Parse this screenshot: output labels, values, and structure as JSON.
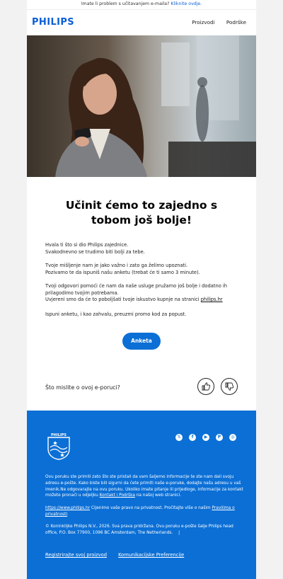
{
  "preheader": {
    "text": "Imate li problem s učitavanjem e-maila?",
    "link": "Kliknite ovdje."
  },
  "brand": {
    "logo": "PHILIPS",
    "emblem_word": "PHILIPS"
  },
  "nav": {
    "products": "Proizvodi",
    "support": "Podrške"
  },
  "main": {
    "headline": "Učinit ćemo to zajedno s tobom još bolje!",
    "p1_line1": "Hvala ti što si dio Philips zajednice.",
    "p1_line2": "Svakodnevno se trudimo biti bolji za tebe.",
    "p2_line1": "Tvoje mišljenje nam je jako važno i zato ga želimo upoznati.",
    "p2_line2": "Pozivamo te da ispuniš našu anketu (trebat će ti samo 3 minute).",
    "p3_line1": "Tvoji odgovori pomoći će nam da naše usluge pružamo još bolje i dodatno ih",
    "p3_line2": "prilagodimo tvojim potrebama.",
    "p3_line3_pre": "Uvjereni smo da će to poboljšati tvoje iskustvo kupnje na stranici ",
    "p3_link": "philips.hr",
    "p4": "Ispuni anketu, i kao zahvalu, preuzmi promo kod za popust.",
    "button": "Anketa"
  },
  "feedback": {
    "question": "Što mislite o ovoj e-poruci?"
  },
  "footer": {
    "legal1": "Ovu poruku ste primili zato što ste pristali da vam šaljemo informacije te ste nam dali svoju adresu e-pošte. Kako biste bili sigurni da ćete primiti naše e-poruke, dodajte našu adresu u vaš imenik.Ne odgovarajte na ovu poruku. Ukoliko imate pitanje ili prijedloge, informacije za kontakt možete pronaći u odjeljku",
    "legal1_link": "Kontakt i Podrška",
    "legal1_end": "na našoj web stranici.",
    "privacy_link": "https://www.philips.hr",
    "privacy_mid": "Cijenimo vaše pravo na privatnost. Pročitajte više o našim",
    "privacy_link2": "Pravilima o privatnosti",
    "copyright": "© Koninklijke Philips N.V., 2026. Sva prava pridržana. Ovu poruku e-pošte šalje Philips head office, P.O. Box 77900, 1096 BC Amsterdam, The Netherlands.",
    "separator": "|",
    "link_register": "Registrirajte svoj proizvod",
    "link_prefs": "Komunikacijske Preferencije"
  },
  "social": [
    {
      "name": "x-icon",
      "glyph": "𝕏"
    },
    {
      "name": "facebook-icon",
      "glyph": "f"
    },
    {
      "name": "youtube-icon",
      "glyph": "▶"
    },
    {
      "name": "pinterest-icon",
      "glyph": "P"
    },
    {
      "name": "instagram-icon",
      "glyph": "◎"
    }
  ],
  "colors": {
    "brand_blue": "#0b6fd6",
    "logo_blue": "#0b5ed7"
  }
}
